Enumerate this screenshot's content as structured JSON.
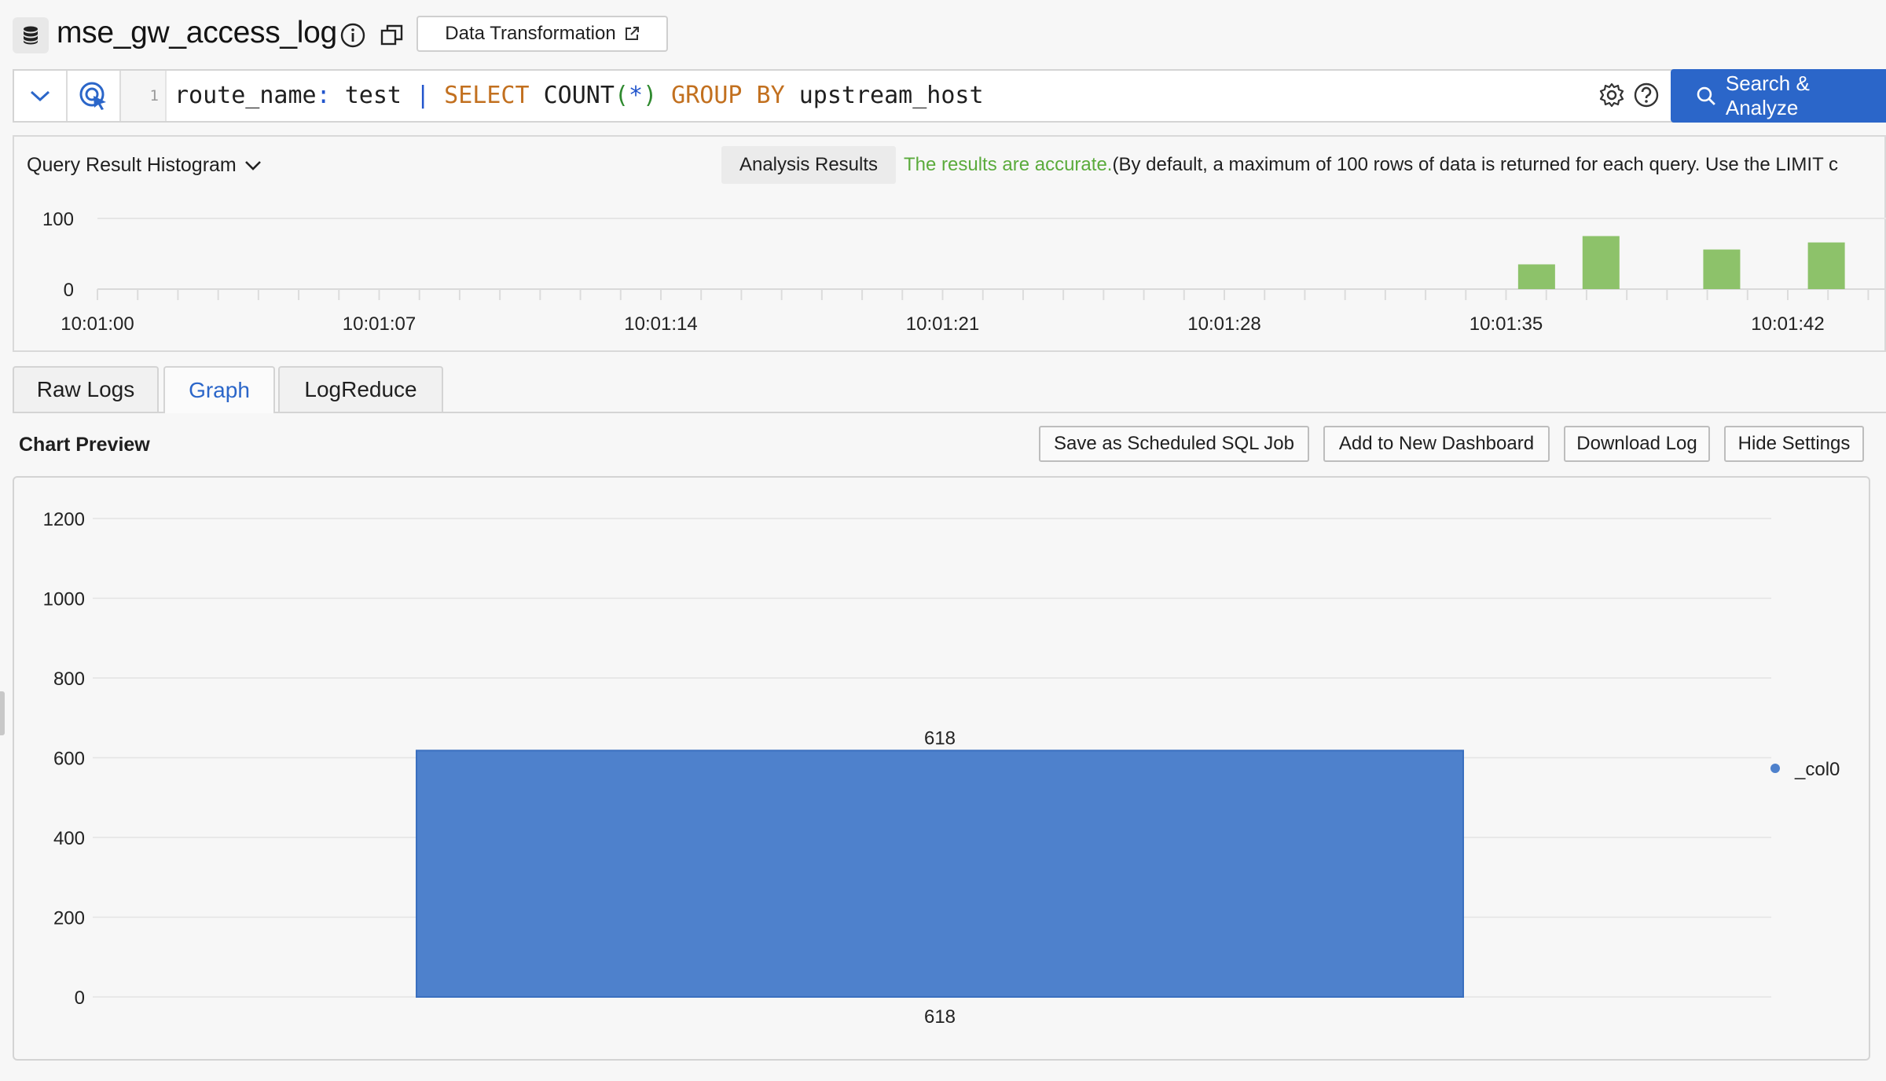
{
  "header": {
    "logstore_name": "mse_gw_access_log",
    "data_transformation_label": "Data Transformation"
  },
  "query": {
    "line_number": "1",
    "tokens": [
      {
        "text": "route_name",
        "cls": ""
      },
      {
        "text": ":",
        "cls": "pipe"
      },
      {
        "text": " test ",
        "cls": ""
      },
      {
        "text": "|",
        "cls": "pipe"
      },
      {
        "text": " SELECT ",
        "cls": "kw"
      },
      {
        "text": "COUNT",
        "cls": ""
      },
      {
        "text": "(",
        "cls": "paren"
      },
      {
        "text": "*",
        "cls": "pipe"
      },
      {
        "text": ")",
        "cls": "paren"
      },
      {
        "text": " GROUP BY ",
        "cls": "kw"
      },
      {
        "text": "upstream_host",
        "cls": ""
      }
    ],
    "search_button_label": "Search & Analyze"
  },
  "histogram": {
    "title": "Query Result Histogram",
    "analysis_label": "Analysis Results",
    "accurate_text": "The results are accurate.",
    "note_text": "(By default, a maximum of 100 rows of data is returned for each query. Use the LIMIT c",
    "bar_color": "#8dc26a",
    "chart_data": {
      "type": "bar",
      "x_tick_labels": [
        "10:01:00",
        "10:01:07",
        "10:01:14",
        "10:01:21",
        "10:01:28",
        "10:01:35",
        "10:01:42"
      ],
      "y_tick_labels": [
        "0",
        "100"
      ],
      "ylim": [
        0,
        100
      ],
      "x_range_seconds": [
        0,
        44
      ],
      "bars": [
        {
          "t": 35.3,
          "value": 35
        },
        {
          "t": 36.9,
          "value": 75
        },
        {
          "t": 39.9,
          "value": 56
        },
        {
          "t": 42.5,
          "value": 66
        }
      ]
    }
  },
  "tabs": [
    {
      "label": "Raw Logs",
      "active": false
    },
    {
      "label": "Graph",
      "active": true
    },
    {
      "label": "LogReduce",
      "active": false
    }
  ],
  "chart_preview": {
    "title": "Chart Preview",
    "buttons": {
      "save_sql_job": "Save as Scheduled SQL Job",
      "add_dashboard": "Add to New Dashboard",
      "download_log": "Download Log",
      "hide_settings": "Hide Settings"
    }
  },
  "chart_data": {
    "type": "bar",
    "categories": [
      "618"
    ],
    "series": [
      {
        "name": "_col0",
        "values": [
          618
        ]
      }
    ],
    "ylim": [
      0,
      1200
    ],
    "y_ticks": [
      0,
      200,
      400,
      600,
      800,
      1000,
      1200
    ],
    "bar_color": "#4e81cc",
    "data_label": "618",
    "legend_position": "right"
  }
}
